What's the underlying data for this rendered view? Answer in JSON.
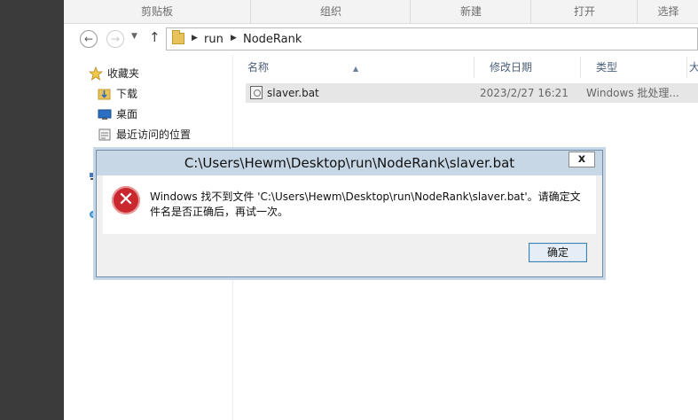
{
  "ribbon": {
    "groups": [
      "剪贴板",
      "组织",
      "新建",
      "打开",
      "选择"
    ]
  },
  "address": {
    "back_icon": "back-arrow-icon",
    "forward_icon": "forward-arrow-icon",
    "crumbs": [
      "run",
      "NodeRank"
    ]
  },
  "nav": {
    "items": [
      {
        "label": "收藏夹",
        "icon": "star-icon"
      },
      {
        "label": "下载",
        "icon": "download-folder-icon"
      },
      {
        "label": "桌面",
        "icon": "desktop-icon"
      },
      {
        "label": "最近访问的位置",
        "icon": "recent-places-icon"
      }
    ]
  },
  "files": {
    "columns": [
      "名称",
      "修改日期",
      "类型",
      "大"
    ],
    "rows": [
      {
        "name": "slaver.bat",
        "modified": "2023/2/27 16:21",
        "type": "Windows 批处理..."
      }
    ]
  },
  "dialog": {
    "title": "C:\\Users\\Hewm\\Desktop\\run\\NodeRank\\slaver.bat",
    "close_label": "x",
    "message": "Windows 找不到文件 'C:\\Users\\Hewm\\Desktop\\run\\NodeRank\\slaver.bat'。请确定文件名是否正确后，再试一次。",
    "ok_label": "确定",
    "icon": "error-icon",
    "icon_glyph": "✕"
  },
  "colors": {
    "title_bar": "#c7d7e6",
    "error": "#c8282e",
    "column_header": "#4c607a",
    "selected_row": "#e6e6e6"
  }
}
